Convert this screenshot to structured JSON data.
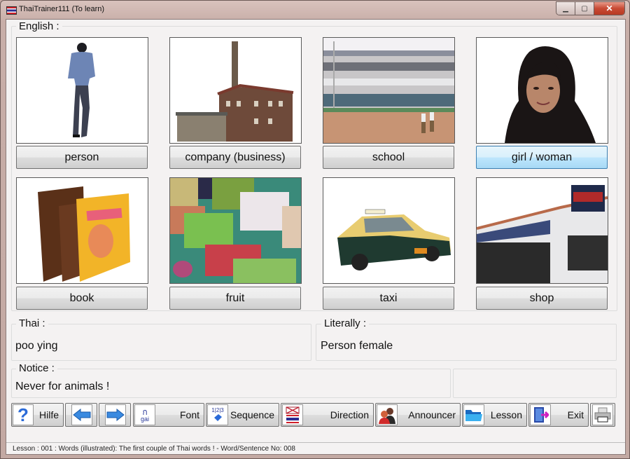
{
  "window": {
    "title": "ThaiTrainer111 (To learn)",
    "controls": {
      "minimize": "▁",
      "maximize": "▢",
      "close": "✕"
    }
  },
  "english": {
    "label": "English :",
    "tiles": [
      {
        "label": "person",
        "image": "man-walking-photo",
        "selected": false
      },
      {
        "label": "company (business)",
        "image": "factory-building-photo",
        "selected": false
      },
      {
        "label": "school",
        "image": "school-building-photo",
        "selected": false
      },
      {
        "label": "girl / woman",
        "image": "woman-portrait-photo",
        "selected": true
      },
      {
        "label": "book",
        "image": "books-photo",
        "selected": false
      },
      {
        "label": "fruit",
        "image": "fruit-market-photo",
        "selected": false
      },
      {
        "label": "taxi",
        "image": "taxi-car-photo",
        "selected": false
      },
      {
        "label": "shop",
        "image": "minimart-shop-photo",
        "selected": false
      }
    ]
  },
  "thai": {
    "label": "Thai :",
    "value": "poo ying"
  },
  "literally": {
    "label": "Literally :",
    "value": "Person female"
  },
  "notice": {
    "label": "Notice :",
    "value": "Never for animals !"
  },
  "toolbar": {
    "help": {
      "label": "Hilfe",
      "icon": "question-icon"
    },
    "back": {
      "icon": "arrow-left-icon"
    },
    "forward": {
      "icon": "arrow-right-icon"
    },
    "font": {
      "label": "Font",
      "icon": "thai-font-icon",
      "icon_text_top": "ก",
      "icon_text_bottom": "gai"
    },
    "sequence": {
      "label": "Sequence",
      "icon": "sequence-icon",
      "icon_text": "1|2|3"
    },
    "direction": {
      "label": "Direction",
      "icon": "flags-icon"
    },
    "announcer": {
      "label": "Announcer",
      "icon": "people-icon"
    },
    "lesson": {
      "label": "Lesson",
      "icon": "folder-icon"
    },
    "exit": {
      "label": "Exit",
      "icon": "exit-door-icon"
    },
    "print": {
      "icon": "printer-icon"
    }
  },
  "status": {
    "text": "Lesson : 001 : Words (illustrated): The first couple of Thai words ! - Word/Sentence No: 008"
  },
  "colors": {
    "selected_button": "#bee6fd",
    "window_frame": "#c7aca6",
    "client_bg": "#f4f2f2"
  }
}
